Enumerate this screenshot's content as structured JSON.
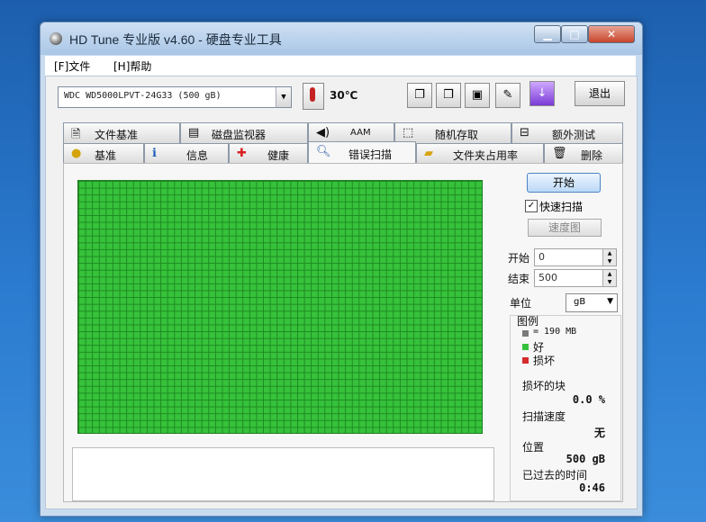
{
  "window": {
    "title": "HD Tune 专业版 v4.60 - 硬盘专业工具"
  },
  "menu": {
    "file": "[F]文件",
    "help": "[H]帮助"
  },
  "toolbar": {
    "drive": "WDC WD5000LPVT-24G33    (500 gB)",
    "temperature": "30℃",
    "exit_label": "退出"
  },
  "tabs_top": [
    {
      "label": "文件基准",
      "icon": "document-icon"
    },
    {
      "label": "磁盘监视器",
      "icon": "monitor-icon"
    },
    {
      "label": "AAM",
      "icon": "speaker-icon"
    },
    {
      "label": "随机存取",
      "icon": "random-access-icon"
    },
    {
      "label": "额外测试",
      "icon": "extra-test-icon"
    }
  ],
  "tabs_bottom": [
    {
      "label": "基准",
      "icon": "lightbulb-icon"
    },
    {
      "label": "信息",
      "icon": "info-icon"
    },
    {
      "label": "健康",
      "icon": "health-cross-icon"
    },
    {
      "label": "错误扫描",
      "icon": "magnifier-icon",
      "active": true
    },
    {
      "label": "文件夹占用率",
      "icon": "folder-icon"
    },
    {
      "label": "删除",
      "icon": "trash-icon"
    }
  ],
  "scan": {
    "start_label": "开始",
    "quick_scan_label": "快速扫描",
    "quick_scan_checked": true,
    "speed_map_label": "速度图",
    "start_field_label": "开始",
    "start_value": "0",
    "end_field_label": "结束",
    "end_value": "500",
    "unit_label": "单位",
    "unit_value": "gB",
    "legend_title": "图例",
    "legend_block": "= 190 MB",
    "legend_good": "好",
    "legend_bad": "损坏",
    "damaged_blocks_label": "损坏的块",
    "damaged_blocks_value": "0.0 %",
    "scan_speed_label": "扫描速度",
    "scan_speed_value": "无",
    "position_label": "位置",
    "position_value": "500 gB",
    "elapsed_label": "已过去的时间",
    "elapsed_value": "0:46",
    "colors": {
      "good": "#36c23a",
      "bad": "#d62b2b",
      "block": "#7a7a7a"
    }
  }
}
